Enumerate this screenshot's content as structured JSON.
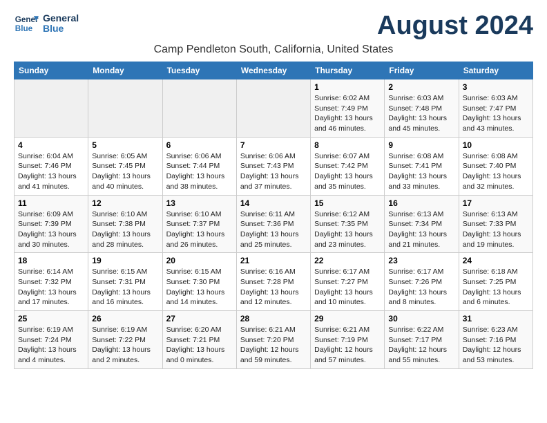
{
  "header": {
    "logo_line1": "General",
    "logo_line2": "Blue",
    "title": "August 2024",
    "subtitle": "Camp Pendleton South, California, United States"
  },
  "days_of_week": [
    "Sunday",
    "Monday",
    "Tuesday",
    "Wednesday",
    "Thursday",
    "Friday",
    "Saturday"
  ],
  "weeks": [
    [
      {
        "day": "",
        "info": ""
      },
      {
        "day": "",
        "info": ""
      },
      {
        "day": "",
        "info": ""
      },
      {
        "day": "",
        "info": ""
      },
      {
        "day": "1",
        "info": "Sunrise: 6:02 AM\nSunset: 7:49 PM\nDaylight: 13 hours\nand 46 minutes."
      },
      {
        "day": "2",
        "info": "Sunrise: 6:03 AM\nSunset: 7:48 PM\nDaylight: 13 hours\nand 45 minutes."
      },
      {
        "day": "3",
        "info": "Sunrise: 6:03 AM\nSunset: 7:47 PM\nDaylight: 13 hours\nand 43 minutes."
      }
    ],
    [
      {
        "day": "4",
        "info": "Sunrise: 6:04 AM\nSunset: 7:46 PM\nDaylight: 13 hours\nand 41 minutes."
      },
      {
        "day": "5",
        "info": "Sunrise: 6:05 AM\nSunset: 7:45 PM\nDaylight: 13 hours\nand 40 minutes."
      },
      {
        "day": "6",
        "info": "Sunrise: 6:06 AM\nSunset: 7:44 PM\nDaylight: 13 hours\nand 38 minutes."
      },
      {
        "day": "7",
        "info": "Sunrise: 6:06 AM\nSunset: 7:43 PM\nDaylight: 13 hours\nand 37 minutes."
      },
      {
        "day": "8",
        "info": "Sunrise: 6:07 AM\nSunset: 7:42 PM\nDaylight: 13 hours\nand 35 minutes."
      },
      {
        "day": "9",
        "info": "Sunrise: 6:08 AM\nSunset: 7:41 PM\nDaylight: 13 hours\nand 33 minutes."
      },
      {
        "day": "10",
        "info": "Sunrise: 6:08 AM\nSunset: 7:40 PM\nDaylight: 13 hours\nand 32 minutes."
      }
    ],
    [
      {
        "day": "11",
        "info": "Sunrise: 6:09 AM\nSunset: 7:39 PM\nDaylight: 13 hours\nand 30 minutes."
      },
      {
        "day": "12",
        "info": "Sunrise: 6:10 AM\nSunset: 7:38 PM\nDaylight: 13 hours\nand 28 minutes."
      },
      {
        "day": "13",
        "info": "Sunrise: 6:10 AM\nSunset: 7:37 PM\nDaylight: 13 hours\nand 26 minutes."
      },
      {
        "day": "14",
        "info": "Sunrise: 6:11 AM\nSunset: 7:36 PM\nDaylight: 13 hours\nand 25 minutes."
      },
      {
        "day": "15",
        "info": "Sunrise: 6:12 AM\nSunset: 7:35 PM\nDaylight: 13 hours\nand 23 minutes."
      },
      {
        "day": "16",
        "info": "Sunrise: 6:13 AM\nSunset: 7:34 PM\nDaylight: 13 hours\nand 21 minutes."
      },
      {
        "day": "17",
        "info": "Sunrise: 6:13 AM\nSunset: 7:33 PM\nDaylight: 13 hours\nand 19 minutes."
      }
    ],
    [
      {
        "day": "18",
        "info": "Sunrise: 6:14 AM\nSunset: 7:32 PM\nDaylight: 13 hours\nand 17 minutes."
      },
      {
        "day": "19",
        "info": "Sunrise: 6:15 AM\nSunset: 7:31 PM\nDaylight: 13 hours\nand 16 minutes."
      },
      {
        "day": "20",
        "info": "Sunrise: 6:15 AM\nSunset: 7:30 PM\nDaylight: 13 hours\nand 14 minutes."
      },
      {
        "day": "21",
        "info": "Sunrise: 6:16 AM\nSunset: 7:28 PM\nDaylight: 13 hours\nand 12 minutes."
      },
      {
        "day": "22",
        "info": "Sunrise: 6:17 AM\nSunset: 7:27 PM\nDaylight: 13 hours\nand 10 minutes."
      },
      {
        "day": "23",
        "info": "Sunrise: 6:17 AM\nSunset: 7:26 PM\nDaylight: 13 hours\nand 8 minutes."
      },
      {
        "day": "24",
        "info": "Sunrise: 6:18 AM\nSunset: 7:25 PM\nDaylight: 13 hours\nand 6 minutes."
      }
    ],
    [
      {
        "day": "25",
        "info": "Sunrise: 6:19 AM\nSunset: 7:24 PM\nDaylight: 13 hours\nand 4 minutes."
      },
      {
        "day": "26",
        "info": "Sunrise: 6:19 AM\nSunset: 7:22 PM\nDaylight: 13 hours\nand 2 minutes."
      },
      {
        "day": "27",
        "info": "Sunrise: 6:20 AM\nSunset: 7:21 PM\nDaylight: 13 hours\nand 0 minutes."
      },
      {
        "day": "28",
        "info": "Sunrise: 6:21 AM\nSunset: 7:20 PM\nDaylight: 12 hours\nand 59 minutes."
      },
      {
        "day": "29",
        "info": "Sunrise: 6:21 AM\nSunset: 7:19 PM\nDaylight: 12 hours\nand 57 minutes."
      },
      {
        "day": "30",
        "info": "Sunrise: 6:22 AM\nSunset: 7:17 PM\nDaylight: 12 hours\nand 55 minutes."
      },
      {
        "day": "31",
        "info": "Sunrise: 6:23 AM\nSunset: 7:16 PM\nDaylight: 12 hours\nand 53 minutes."
      }
    ]
  ]
}
